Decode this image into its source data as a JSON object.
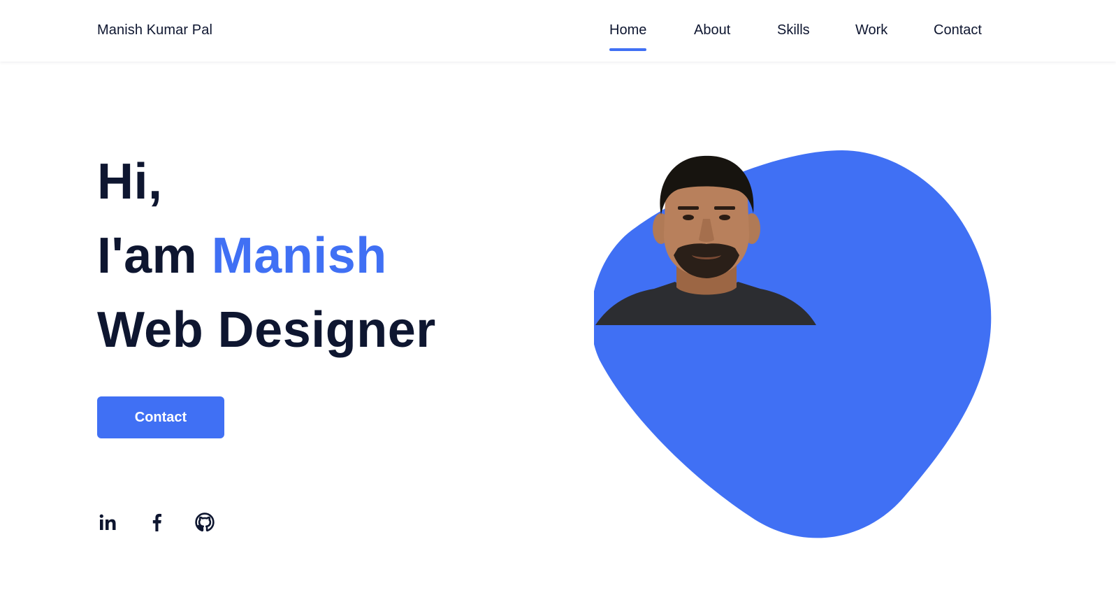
{
  "colors": {
    "accent": "#4070f4",
    "text": "#0e1630"
  },
  "header": {
    "brand": "Manish Kumar Pal",
    "nav": [
      {
        "label": "Home",
        "active": true
      },
      {
        "label": "About",
        "active": false
      },
      {
        "label": "Skills",
        "active": false
      },
      {
        "label": "Work",
        "active": false
      },
      {
        "label": "Contact",
        "active": false
      }
    ]
  },
  "hero": {
    "greeting": "Hi,",
    "intro_prefix": "I'am ",
    "name": "Manish",
    "role": "Web Designer",
    "cta_label": "Contact"
  },
  "social": [
    {
      "icon": "linkedin-icon"
    },
    {
      "icon": "facebook-icon"
    },
    {
      "icon": "github-icon"
    }
  ]
}
